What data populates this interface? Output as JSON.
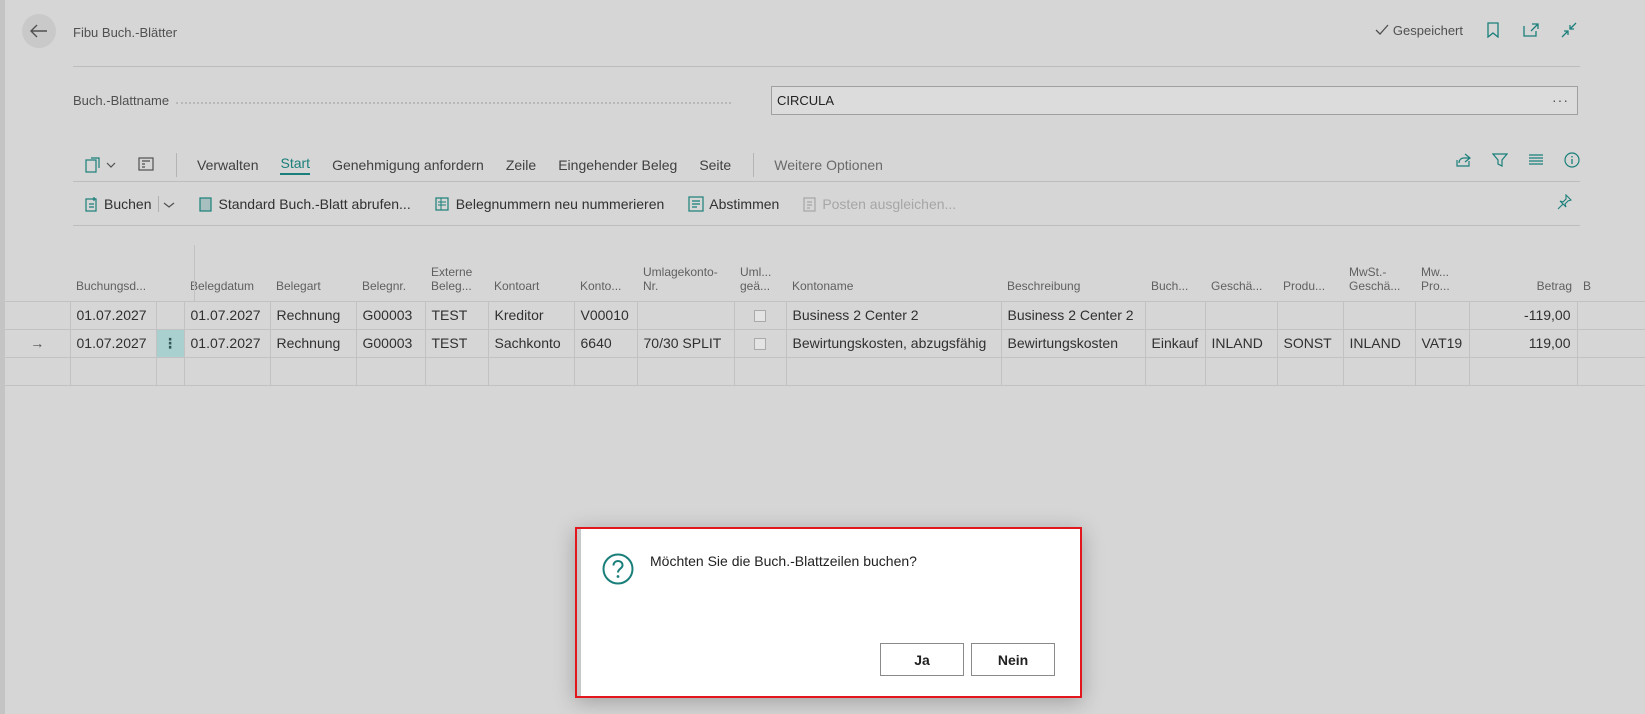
{
  "header": {
    "title": "Fibu Buch.-Blätter",
    "saved_label": "Gespeichert"
  },
  "field": {
    "label": "Buch.-Blattname",
    "value": "CIRCULA",
    "more": "···"
  },
  "tabs": [
    "Verwalten",
    "Start",
    "Genehmigung anfordern",
    "Zeile",
    "Eingehender Beleg",
    "Seite"
  ],
  "more_options": "Weitere Optionen",
  "commands": {
    "post": "Buchen",
    "standard": "Standard Buch.-Blatt abrufen...",
    "renumber": "Belegnummern neu nummerieren",
    "reconcile": "Abstimmen",
    "apply": "Posten ausgleichen..."
  },
  "columns": [
    "Buchungsd...",
    "Belegdatum",
    "Belegart",
    "Belegnr.",
    "Externe Beleg...",
    "Kontoart",
    "Konto...",
    "Umlagekonto-Nr.",
    "Uml... geä...",
    "Kontoname",
    "Beschreibung",
    "Buch...",
    "Geschä...",
    "Produ...",
    "MwSt.-Geschä...",
    "Mw... Pro...",
    "Betrag",
    "B"
  ],
  "rows": [
    {
      "posting_date": "01.07.2027",
      "doc_date": "01.07.2027",
      "doc_type": "Rechnung",
      "doc_no": "G00003",
      "ext_doc": "TEST",
      "acc_type": "Kreditor",
      "acc_no": "V00010",
      "alloc": "",
      "acc_name": "Business 2 Center 2",
      "desc": "Business 2 Center 2",
      "buch": "",
      "gesch": "",
      "prod": "",
      "mwst_gesch": "",
      "mwst_prod": "",
      "amount": "-119,00"
    },
    {
      "posting_date": "01.07.2027",
      "doc_date": "01.07.2027",
      "doc_type": "Rechnung",
      "doc_no": "G00003",
      "ext_doc": "TEST",
      "acc_type": "Sachkonto",
      "acc_no": "6640",
      "alloc": "70/30 SPLIT",
      "acc_name": "Bewirtungskosten, abzugsfähig",
      "desc": "Bewirtungskosten",
      "buch": "Einkauf",
      "gesch": "INLAND",
      "prod": "SONST",
      "mwst_gesch": "INLAND",
      "mwst_prod": "VAT19",
      "amount": "119,00"
    }
  ],
  "row_indicator": "→",
  "row_menu": "⋮",
  "dialog": {
    "message": "Möchten Sie die Buch.-Blattzeilen buchen?",
    "yes": "Ja",
    "no": "Nein"
  },
  "colors": {
    "accent": "#1a7f7a",
    "dialog_border": "#e2161c"
  }
}
